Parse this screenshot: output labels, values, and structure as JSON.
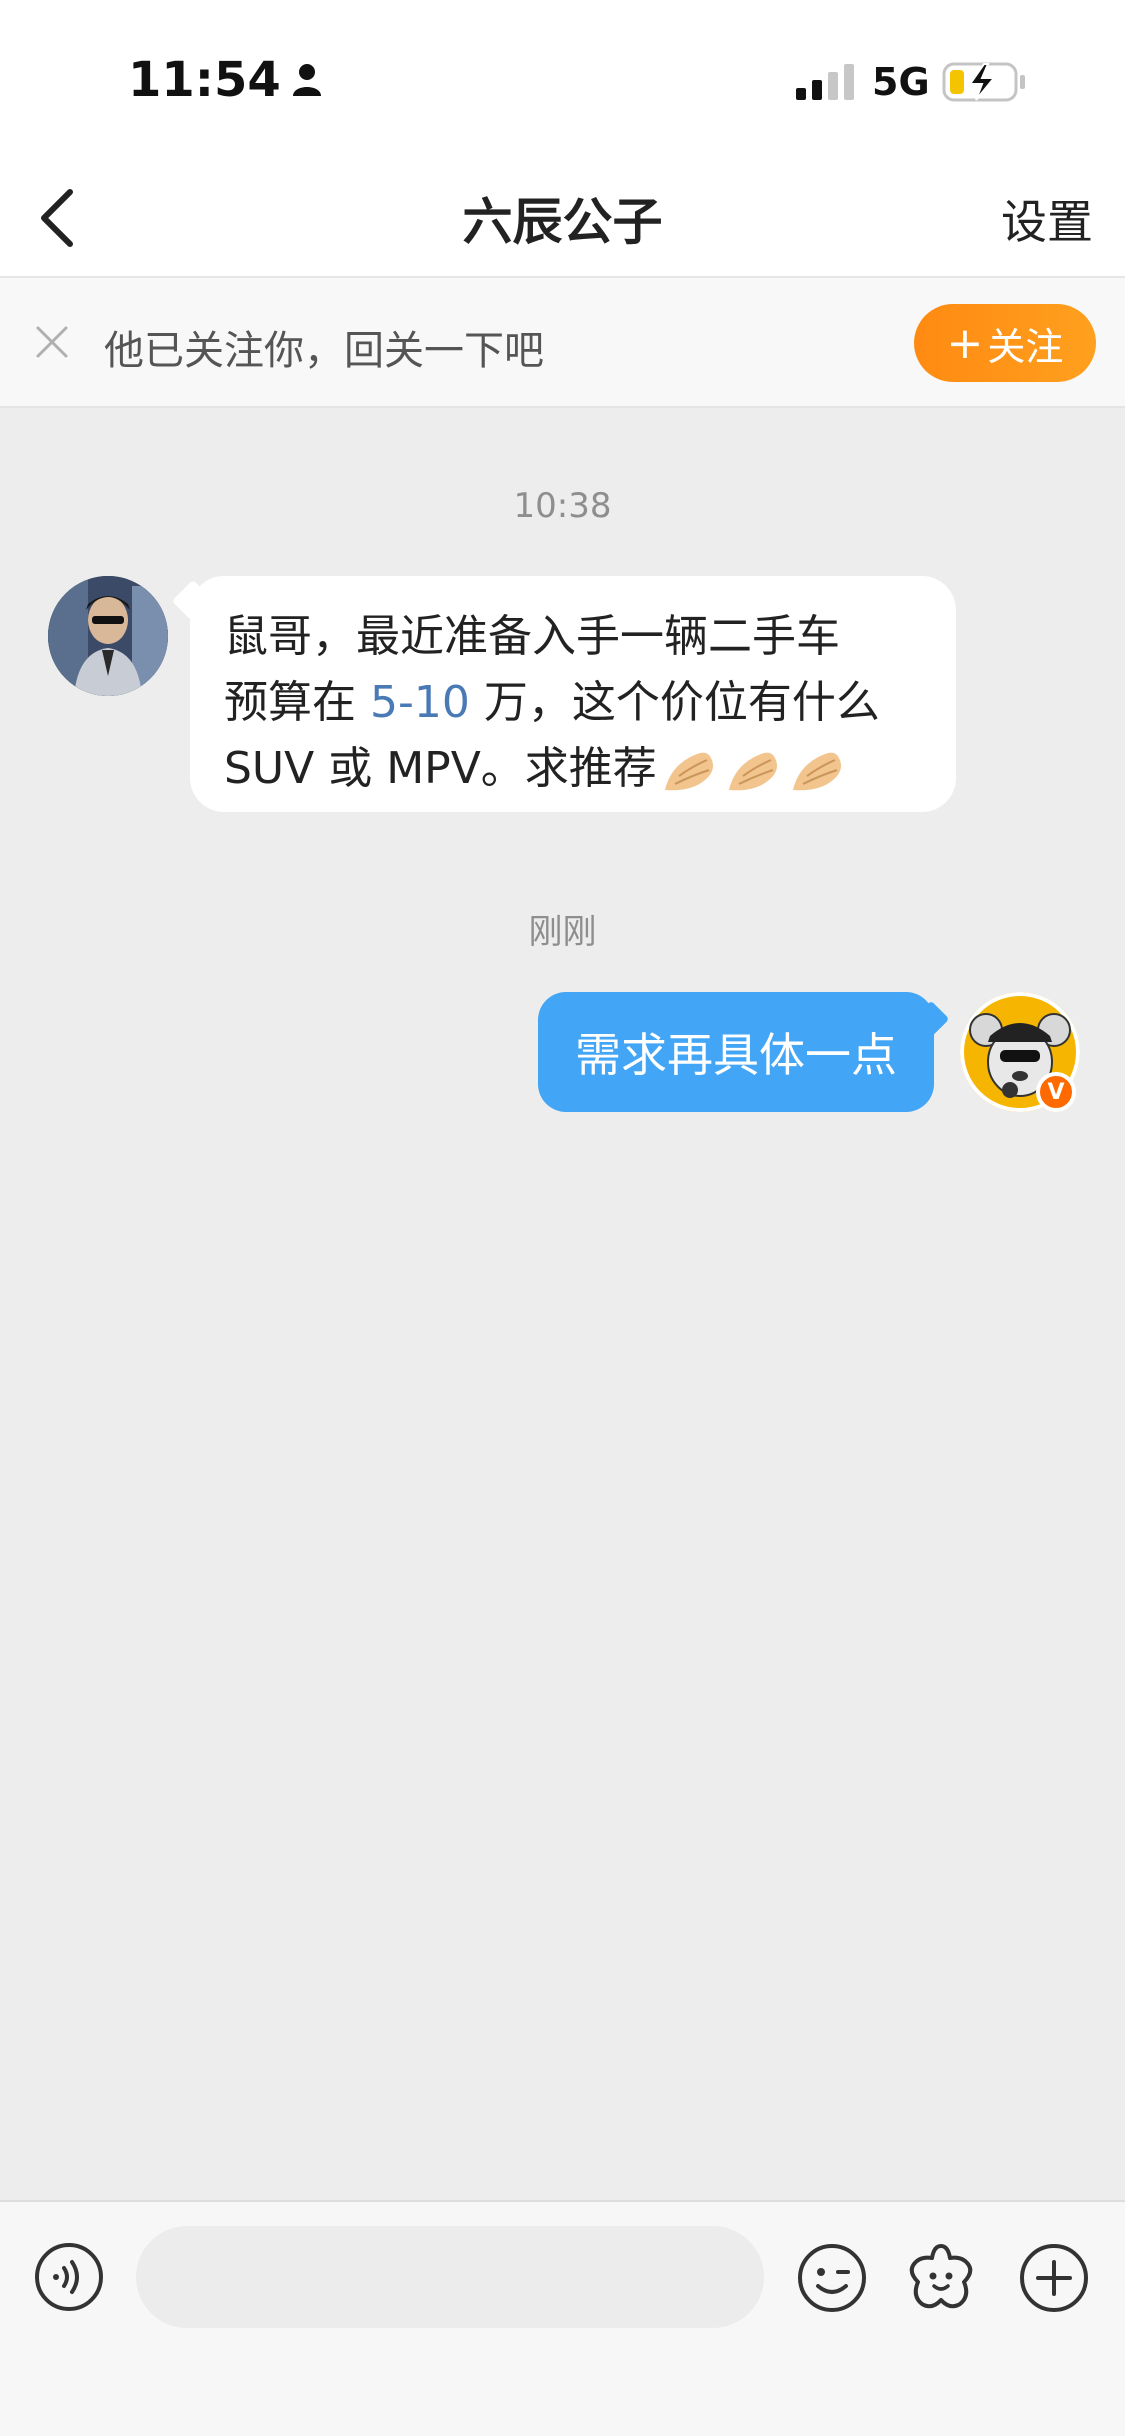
{
  "status_bar": {
    "time": "11:54",
    "network": "5G"
  },
  "nav": {
    "title": "六辰公子",
    "settings_label": "设置"
  },
  "follow_banner": {
    "text": "他已关注你，回关一下吧",
    "button_label": "关注"
  },
  "messages": [
    {
      "timestamp": "10:38",
      "side": "left",
      "lines": [
        {
          "text": "鼠哥，最近准备入手一辆二手车"
        },
        {
          "before": "预算在 ",
          "highlight": "5-10",
          "after": " 万，这个价位有什么"
        },
        {
          "text": " SUV 或 MPV。求推荐"
        }
      ],
      "emoji": [
        "🤌",
        "🤌",
        "🤌"
      ]
    },
    {
      "timestamp": "刚刚",
      "side": "right",
      "text": "需求再具体一点"
    }
  ],
  "verified_badge": "V",
  "input_bar": {
    "placeholder": ""
  },
  "colors": {
    "accent_orange": "#ff8a12",
    "bubble_blue": "#42a5f5",
    "highlight_blue": "#4a7ab6",
    "background": "#ededed"
  },
  "icons": [
    "person-icon",
    "signal-icon",
    "battery-charging-icon",
    "back-chevron-icon",
    "close-icon",
    "voice-icon",
    "emoji-icon",
    "sticker-icon",
    "plus-icon"
  ]
}
